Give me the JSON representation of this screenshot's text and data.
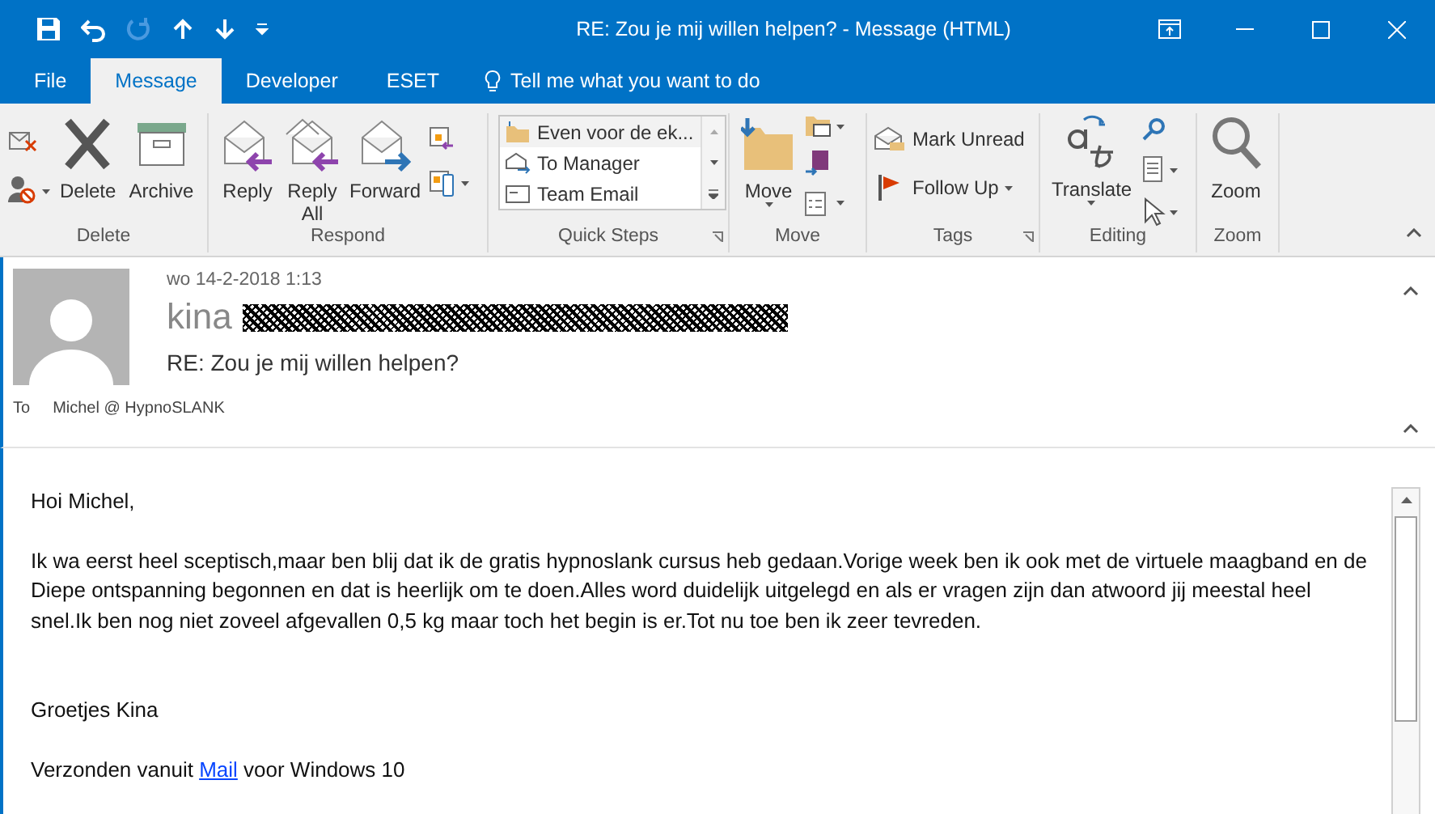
{
  "window": {
    "title": "RE: Zou je mij willen helpen?  -  Message (HTML)"
  },
  "tabs": [
    {
      "label": "File",
      "selected": false
    },
    {
      "label": "Message",
      "selected": true
    },
    {
      "label": "Developer",
      "selected": false
    },
    {
      "label": "ESET",
      "selected": false
    }
  ],
  "tell_me": {
    "placeholder": "Tell me what you want to do"
  },
  "ribbon": {
    "groups": [
      {
        "label": "Delete",
        "items": [
          {
            "label": "Delete"
          },
          {
            "label": "Archive"
          }
        ]
      },
      {
        "label": "Respond",
        "items": [
          {
            "label": "Reply"
          },
          {
            "label": "Reply All"
          },
          {
            "label": "Forward"
          }
        ]
      },
      {
        "label": "Quick Steps",
        "items": [
          {
            "label": "Even voor de ek..."
          },
          {
            "label": "To Manager"
          },
          {
            "label": "Team Email"
          }
        ]
      },
      {
        "label": "Move",
        "items": [
          {
            "label": "Move"
          }
        ]
      },
      {
        "label": "Tags",
        "items": [
          {
            "label": "Mark Unread"
          },
          {
            "label": "Follow Up"
          }
        ]
      },
      {
        "label": "Editing",
        "items": [
          {
            "label": "Translate"
          }
        ]
      },
      {
        "label": "Zoom",
        "items": [
          {
            "label": "Zoom"
          }
        ]
      }
    ]
  },
  "message": {
    "date": "wo 14-2-2018 1:13",
    "sender": "kina",
    "subject": "RE: Zou je mij willen helpen?",
    "to_label": "To",
    "to": "Michel @ HypnoSLANK"
  },
  "body": {
    "paragraphs": [
      {
        "kind": "text",
        "text": "Hoi Michel,"
      },
      {
        "kind": "text",
        "text": "Ik wa eerst heel sceptisch,maar ben blij dat ik de gratis hypnoslank cursus heb gedaan.Vorige week ben ik ook met de virtuele maagband en de Diepe ontspanning begonnen en dat is heerlijk om te doen.Alles word duidelijk uitgelegd en als er vragen zijn dan atwoord jij meestal heel snel.Ik ben nog niet zoveel afgevallen 0,5 kg maar toch het begin is er.Tot nu toe ben ik zeer tevreden."
      },
      {
        "kind": "gap"
      },
      {
        "kind": "text",
        "text": "Groetjes Kina"
      },
      {
        "kind": "link",
        "before": "Verzonden vanuit ",
        "link": "Mail",
        "after": " voor Windows 10"
      }
    ]
  }
}
